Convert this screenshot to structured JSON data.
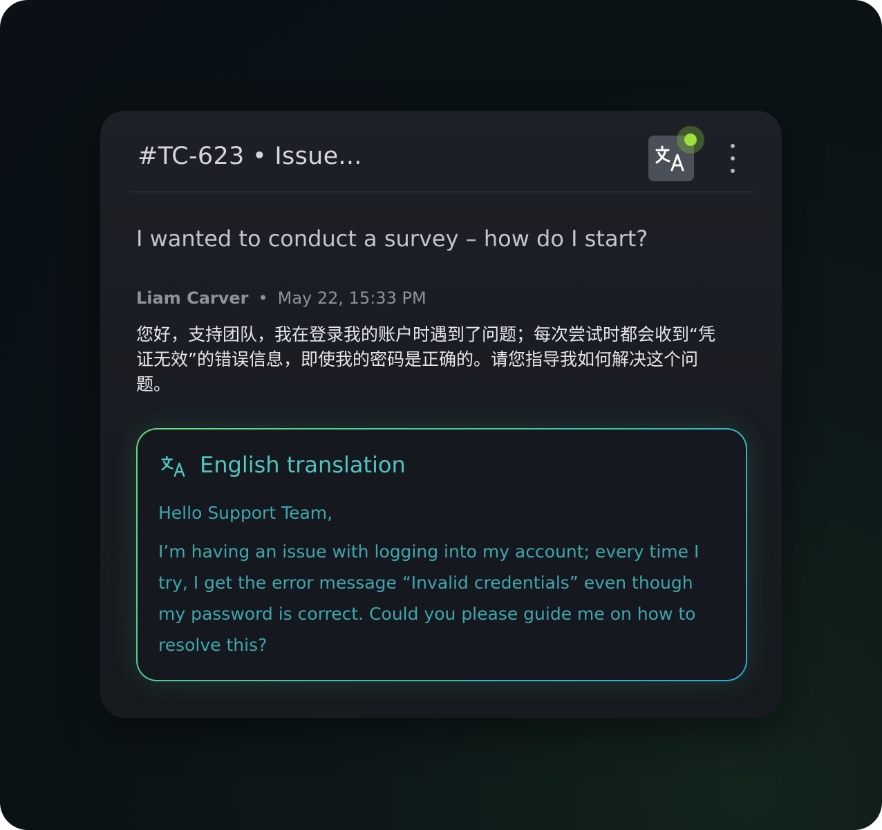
{
  "ticket": {
    "title": "#TC-623 • Issue...",
    "translate_icon": "translate-icon",
    "status_indicator_color": "#9be03f",
    "more_icon": "more-vertical-icon",
    "subject": "I wanted to conduct a survey – how do I start?"
  },
  "message": {
    "author": "Liam Carver",
    "separator": "•",
    "timestamp": "May 22, 15:33 PM",
    "body": "您好，支持团队，我在登录我的账户时遇到了问题；每次尝试时都会收到“凭证无效”的错误信息，即使我的密码是正确的。请您指导我如何解决这个问题。"
  },
  "translation": {
    "icon": "translate-icon",
    "title": "English translation",
    "greeting": "Hello Support Team,",
    "body": "I’m having an issue with logging into my account; every time I try, I get the error message “Invalid credentials” even though my password is correct. Could you please guide me on how to resolve this?",
    "accent_color": "#52c4bd"
  }
}
